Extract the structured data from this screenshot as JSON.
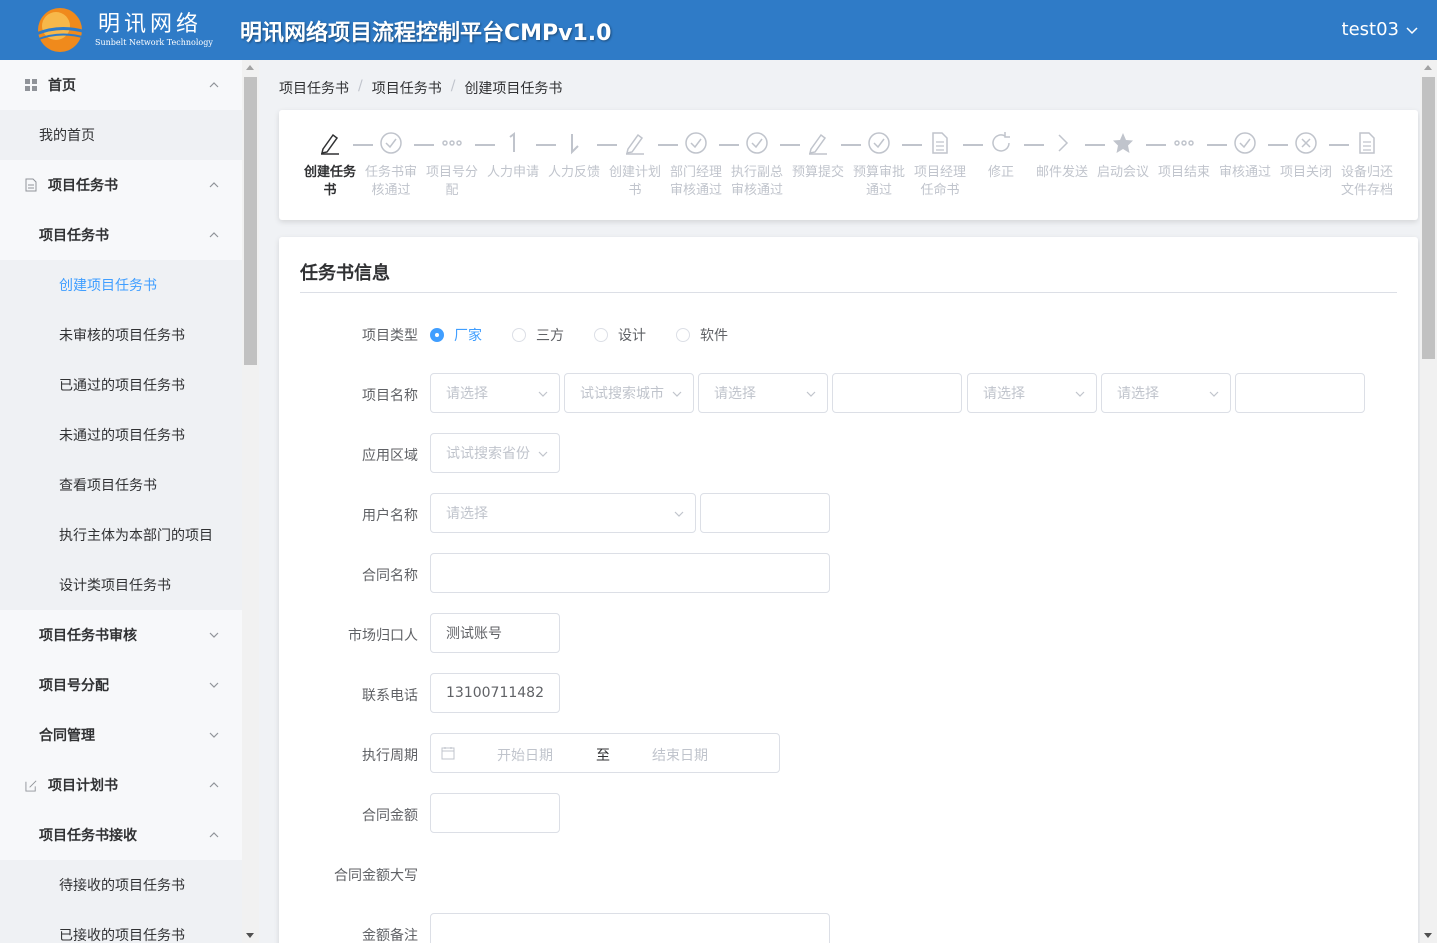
{
  "header": {
    "logo_cn": "明讯网络",
    "logo_en": "Sunbelt Network Technology",
    "title": "明讯网络项目流程控制平台CMPv1.0",
    "user": "test03"
  },
  "sidebar": {
    "items": [
      {
        "label": "首页"
      },
      {
        "label": "我的首页"
      },
      {
        "label": "项目任务书"
      },
      {
        "label": "项目任务书"
      },
      {
        "label": "创建项目任务书"
      },
      {
        "label": "未审核的项目任务书"
      },
      {
        "label": "已通过的项目任务书"
      },
      {
        "label": "未通过的项目任务书"
      },
      {
        "label": "查看项目任务书"
      },
      {
        "label": "执行主体为本部门的项目"
      },
      {
        "label": "设计类项目任务书"
      },
      {
        "label": "项目任务书审核"
      },
      {
        "label": "项目号分配"
      },
      {
        "label": "合同管理"
      },
      {
        "label": "项目计划书"
      },
      {
        "label": "项目任务书接收"
      },
      {
        "label": "待接收的项目任务书"
      },
      {
        "label": "已接收的项目任务书"
      }
    ]
  },
  "breadcrumb": [
    "项目任务书",
    "项目任务书",
    "创建项目任务书"
  ],
  "steps": [
    {
      "l1": "创建任务",
      "l2": "书",
      "icon": "edit-icon"
    },
    {
      "l1": "任务书审",
      "l2": "核通过",
      "icon": "check-circle-icon"
    },
    {
      "l1": "项目号分",
      "l2": "配",
      "icon": "more-icon"
    },
    {
      "l1": "人力申请",
      "l2": "",
      "icon": "one-icon"
    },
    {
      "l1": "人力反馈",
      "l2": "",
      "icon": "arrow-down-icon"
    },
    {
      "l1": "创建计划",
      "l2": "书",
      "icon": "edit-icon"
    },
    {
      "l1": "部门经理",
      "l2": "审核通过",
      "icon": "check-circle-icon"
    },
    {
      "l1": "执行副总",
      "l2": "审核通过",
      "icon": "check-circle-icon"
    },
    {
      "l1": "预算提交",
      "l2": "",
      "icon": "edit-icon"
    },
    {
      "l1": "预算审批",
      "l2": "通过",
      "icon": "check-circle-icon"
    },
    {
      "l1": "项目经理",
      "l2": "任命书",
      "icon": "document-icon"
    },
    {
      "l1": "修正",
      "l2": "",
      "icon": "refresh-icon"
    },
    {
      "l1": "邮件发送",
      "l2": "",
      "icon": "arrow-right-icon"
    },
    {
      "l1": "启动会议",
      "l2": "",
      "icon": "star-icon"
    },
    {
      "l1": "项目结束",
      "l2": "",
      "icon": "more-icon"
    },
    {
      "l1": "审核通过",
      "l2": "",
      "icon": "check-circle-icon"
    },
    {
      "l1": "项目关闭",
      "l2": "",
      "icon": "close-circle-icon"
    },
    {
      "l1": "设备归还",
      "l2": "文件存档",
      "icon": "document-icon"
    }
  ],
  "form": {
    "title": "任务书信息",
    "project_type": {
      "label": "项目类型",
      "options": [
        "厂家",
        "三方",
        "设计",
        "软件"
      ],
      "selected": "厂家"
    },
    "project_name": {
      "label": "项目名称",
      "select1": "请选择",
      "select2": "试试搜索城市",
      "select3": "请选择",
      "select5": "请选择",
      "select6": "请选择"
    },
    "region": {
      "label": "应用区域",
      "placeholder": "试试搜索省份"
    },
    "user_name": {
      "label": "用户名称",
      "placeholder": "请选择"
    },
    "contract_name": {
      "label": "合同名称"
    },
    "market_owner": {
      "label": "市场归口人",
      "value": "测试账号"
    },
    "phone": {
      "label": "联系电话",
      "value": "13100711482"
    },
    "period": {
      "label": "执行周期",
      "start": "开始日期",
      "to": "至",
      "end": "结束日期"
    },
    "amount": {
      "label": "合同金额"
    },
    "amount_cn": {
      "label": "合同金额大写"
    },
    "amount_note": {
      "label": "金额备注"
    }
  },
  "colors": {
    "header": "#2f7bc7",
    "accent": "#409eff"
  }
}
